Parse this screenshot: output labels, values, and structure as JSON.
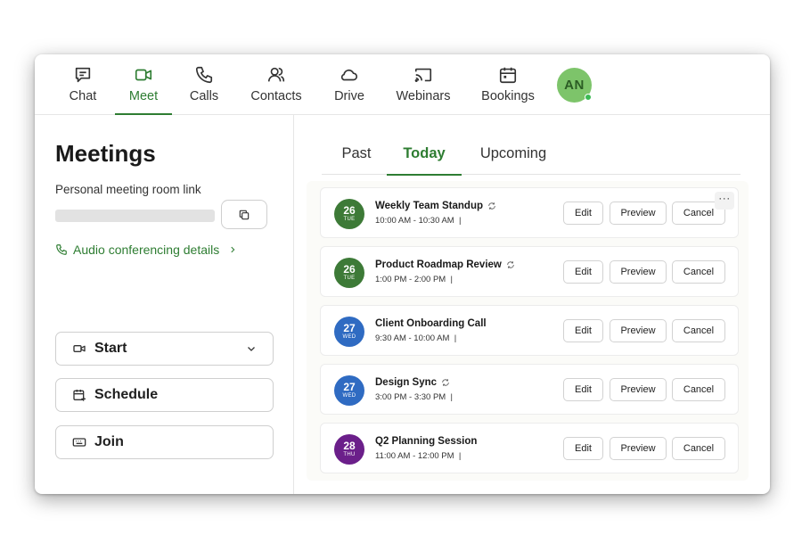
{
  "nav": {
    "items": [
      {
        "label": "Chat",
        "icon": "chat-icon"
      },
      {
        "label": "Meet",
        "icon": "video-icon",
        "active": true
      },
      {
        "label": "Calls",
        "icon": "phone-icon"
      },
      {
        "label": "Contacts",
        "icon": "contacts-icon"
      },
      {
        "label": "Drive",
        "icon": "cloud-icon"
      },
      {
        "label": "Webinars",
        "icon": "cast-icon"
      },
      {
        "label": "Bookings",
        "icon": "calendar-icon"
      }
    ],
    "avatar_initials": "AN",
    "avatar_status": "online"
  },
  "meetings": {
    "title": "Meetings",
    "personal_link_label": "Personal meeting room link",
    "audio_link_label": "Audio conferencing details",
    "start_label": "Start",
    "schedule_label": "Schedule",
    "join_label": "Join"
  },
  "tabs": [
    {
      "label": "Past"
    },
    {
      "label": "Today",
      "active": true
    },
    {
      "label": "Upcoming"
    }
  ],
  "actions": {
    "edit": "Edit",
    "preview": "Preview",
    "cancel": "Cancel",
    "more": "···"
  },
  "list": [
    {
      "day": "26",
      "weekday": "TUE",
      "title": "Weekly Team Standup",
      "time": "10:00 AM - 10:30 AM",
      "recurring": true,
      "color": "#3d7a37"
    },
    {
      "day": "26",
      "weekday": "TUE",
      "title": "Product Roadmap Review",
      "time": "1:00 PM - 2:00 PM",
      "recurring": true,
      "color": "#3d7a37"
    },
    {
      "day": "27",
      "weekday": "WED",
      "title": "Client Onboarding Call",
      "time": "9:30 AM - 10:00 AM",
      "recurring": false,
      "color": "#2f6bc2"
    },
    {
      "day": "27",
      "weekday": "WED",
      "title": "Design Sync",
      "time": "3:00 PM - 3:30 PM",
      "recurring": true,
      "color": "#2f6bc2"
    },
    {
      "day": "28",
      "weekday": "THU",
      "title": "Q2 Planning Session",
      "time": "11:00 AM - 12:00 PM",
      "recurring": false,
      "color": "#6b1f8a"
    }
  ],
  "colors": {
    "accent": "#2e7d32",
    "avatar_bg": "#7dc46a"
  }
}
